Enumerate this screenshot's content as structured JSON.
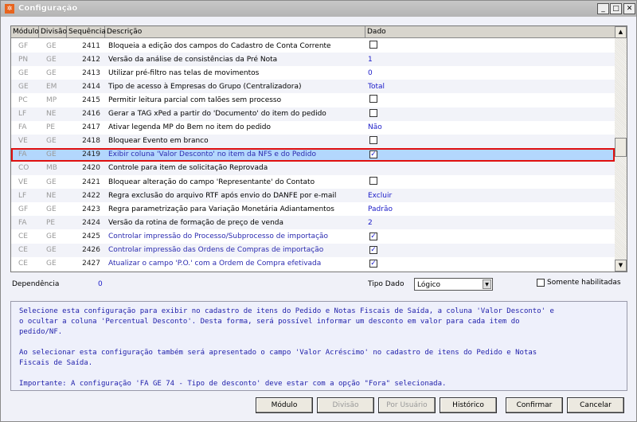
{
  "window": {
    "title": "Configuração",
    "controls": [
      "_",
      "□",
      "✕"
    ]
  },
  "grid": {
    "columns": [
      "Módulo",
      "Divisão",
      "Sequência",
      "Descrição",
      "Dado"
    ],
    "rows": [
      {
        "modulo": "GF",
        "divisao": "GE",
        "seq": "2411",
        "desc": "Bloqueia a edição dos campos do Cadastro de Conta Corrente",
        "dado": "",
        "type": "check",
        "checked": false
      },
      {
        "modulo": "PN",
        "divisao": "GE",
        "seq": "2412",
        "desc": "Versão da análise de consistências da Pré Nota",
        "dado": "1",
        "type": "text"
      },
      {
        "modulo": "GE",
        "divisao": "GE",
        "seq": "2413",
        "desc": "Utilizar pré-filtro nas telas de movimentos",
        "dado": "0",
        "type": "text"
      },
      {
        "modulo": "GE",
        "divisao": "EM",
        "seq": "2414",
        "desc": "Tipo de acesso à Empresas do Grupo (Centralizadora)",
        "dado": "Total",
        "type": "text"
      },
      {
        "modulo": "PC",
        "divisao": "MP",
        "seq": "2415",
        "desc": "Permitir leitura parcial com talões sem processo",
        "dado": "",
        "type": "check",
        "checked": false
      },
      {
        "modulo": "LF",
        "divisao": "NE",
        "seq": "2416",
        "desc": "Gerar a TAG xPed a partir do 'Documento' do item do pedido",
        "dado": "",
        "type": "check",
        "checked": false
      },
      {
        "modulo": "FA",
        "divisao": "PE",
        "seq": "2417",
        "desc": "Ativar legenda MP do Bem no item do pedido",
        "dado": "Não",
        "type": "text"
      },
      {
        "modulo": "VE",
        "divisao": "GE",
        "seq": "2418",
        "desc": "Bloquear Evento em branco",
        "dado": "",
        "type": "check",
        "checked": false
      },
      {
        "modulo": "FA",
        "divisao": "GE",
        "seq": "2419",
        "desc": "Exibir coluna 'Valor Desconto' no item da NFS e do Pedido",
        "dado": "",
        "type": "check",
        "checked": true,
        "selected": true
      },
      {
        "modulo": "CO",
        "divisao": "MB",
        "seq": "2420",
        "desc": "Controle para item de solicitação Reprovada",
        "dado": "",
        "type": "none"
      },
      {
        "modulo": "VE",
        "divisao": "GE",
        "seq": "2421",
        "desc": "Bloquear alteração do campo 'Representante' do Contato",
        "dado": "",
        "type": "check",
        "checked": false
      },
      {
        "modulo": "LF",
        "divisao": "NE",
        "seq": "2422",
        "desc": "Regra exclusão do arquivo RTF após envio do DANFE por e-mail",
        "dado": "Excluir",
        "type": "text"
      },
      {
        "modulo": "GF",
        "divisao": "GE",
        "seq": "2423",
        "desc": "Regra parametrização para Variação Monetária Adiantamentos",
        "dado": "Padrão",
        "type": "text"
      },
      {
        "modulo": "FA",
        "divisao": "PE",
        "seq": "2424",
        "desc": "Versão da rotina de formação de preço de venda",
        "dado": "2",
        "type": "text"
      },
      {
        "modulo": "CE",
        "divisao": "GE",
        "seq": "2425",
        "desc": "Controlar impressão do Processo/Subprocesso de importação",
        "dado": "",
        "type": "check",
        "checked": true,
        "blue": true
      },
      {
        "modulo": "CE",
        "divisao": "GE",
        "seq": "2426",
        "desc": "Controlar impressão das Ordens de Compras de importação",
        "dado": "",
        "type": "check",
        "checked": true,
        "blue": true
      },
      {
        "modulo": "CE",
        "divisao": "GE",
        "seq": "2427",
        "desc": "Atualizar o campo 'P.O.' com a Ordem de Compra efetivada",
        "dado": "",
        "type": "check",
        "checked": true,
        "blue": true
      }
    ]
  },
  "footer": {
    "dependencia_label": "Dependência",
    "dependencia_value": "0",
    "tipo_dado_label": "Tipo Dado",
    "tipo_dado_value": "Lógico",
    "somente_label": "Somente habilitadas"
  },
  "description": "Selecione esta configuração para exibir no cadastro de itens do Pedido e Notas Fiscais de Saída, a coluna 'Valor Desconto' e\no ocultar a coluna 'Percentual Desconto'. Desta forma, será possível informar um desconto em valor para cada item do\npedido/NF.\n\nAo selecionar esta configuração também será apresentado o campo 'Valor Acréscimo' no cadastro de itens do Pedido e Notas\nFiscais de Saída.\n\nImportante: A configuração 'FA GE 74 - Tipo de desconto' deve estar com a opção \"Fora\" selecionada.",
  "buttons": {
    "modulo": "Módulo",
    "divisao": "Divisão",
    "por_usuario": "Por Usuário",
    "historico": "Histórico",
    "confirmar": "Confirmar",
    "cancelar": "Cancelar"
  }
}
